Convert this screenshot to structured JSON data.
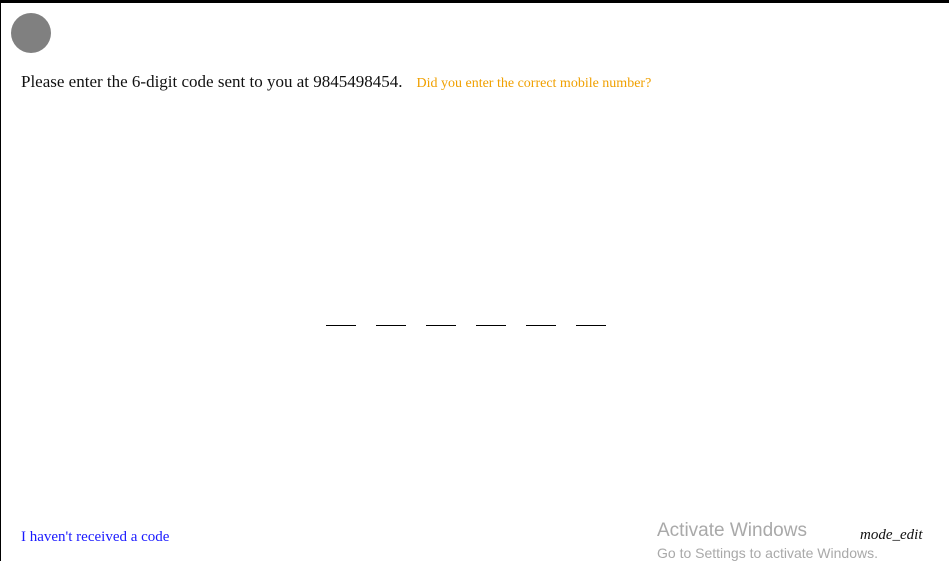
{
  "prompt": {
    "text": "Please enter the 6-digit code sent to you at 9845498454.",
    "wrong_number_link": "Did you enter the correct mobile number?"
  },
  "otp": {
    "digits": [
      "",
      "",
      "",
      "",
      "",
      ""
    ]
  },
  "footer": {
    "no_code_link": "I haven't received a code",
    "mode_label": "mode_edit"
  },
  "watermark": {
    "title": "Activate Windows",
    "subtitle": "Go to Settings to activate Windows."
  },
  "colors": {
    "back_circle": "#808080",
    "link_orange": "#f0a000",
    "link_blue": "#1a1aff",
    "watermark_gray": "#a9a9a9"
  }
}
